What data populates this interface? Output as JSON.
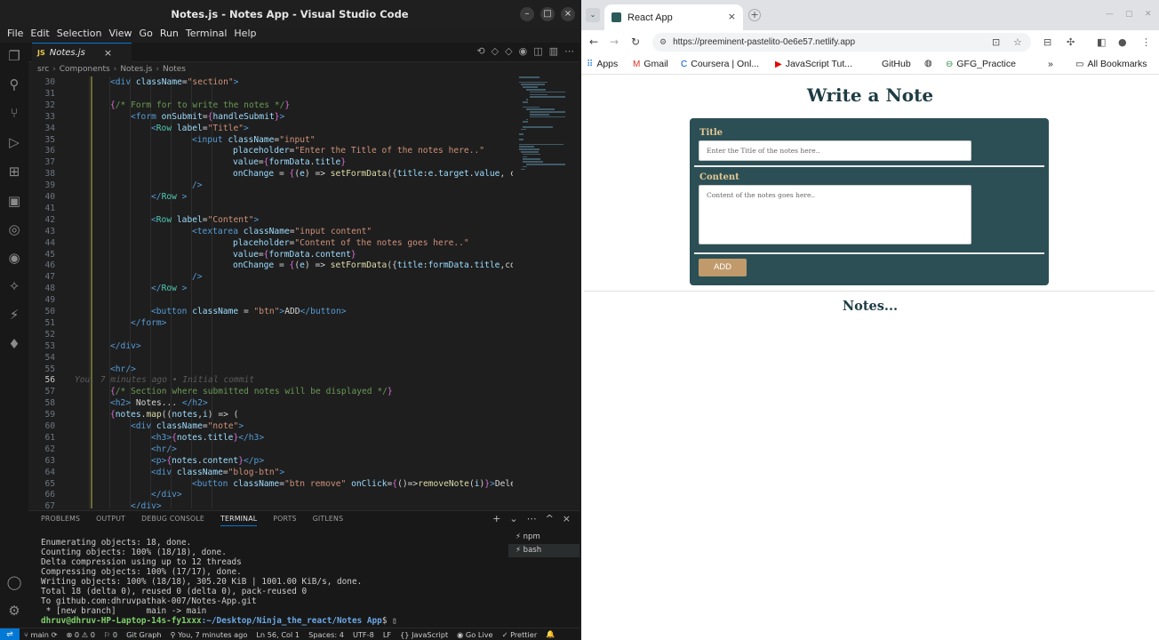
{
  "vscode": {
    "title": "Notes.js - Notes App - Visual Studio Code",
    "menu": [
      "File",
      "Edit",
      "Selection",
      "View",
      "Go",
      "Run",
      "Terminal",
      "Help"
    ],
    "tab": {
      "badge": "JS",
      "label": "Notes.js"
    },
    "breadcrumb": [
      "src",
      "Components",
      "Notes.js",
      "Notes"
    ],
    "blame": "You, 7 minutes ago • Initial commit",
    "lines": [
      {
        "n": "30",
        "tokens": [
          [
            "tag",
            "<div "
          ],
          [
            "attr",
            "className"
          ],
          [
            "plain",
            "="
          ],
          [
            "str",
            "\"section\""
          ],
          [
            "tag",
            ">"
          ]
        ],
        "i": 2
      },
      {
        "n": "31",
        "tokens": [],
        "i": 0
      },
      {
        "n": "32",
        "tokens": [
          [
            "brace",
            "{"
          ],
          [
            "comment",
            "/* Form for to write the notes */"
          ],
          [
            "brace",
            "}"
          ]
        ],
        "i": 2
      },
      {
        "n": "33",
        "tokens": [
          [
            "tag",
            "<form "
          ],
          [
            "attr",
            "onSubmit"
          ],
          [
            "plain",
            "="
          ],
          [
            "brace",
            "{"
          ],
          [
            "var",
            "handleSubmit"
          ],
          [
            "brace",
            "}"
          ],
          [
            "tag",
            ">"
          ]
        ],
        "i": 3
      },
      {
        "n": "34",
        "tokens": [
          [
            "tag",
            "<"
          ],
          [
            "comp",
            "Row "
          ],
          [
            "attr",
            "label"
          ],
          [
            "plain",
            "="
          ],
          [
            "str",
            "\"Title\""
          ],
          [
            "tag",
            ">"
          ]
        ],
        "i": 4
      },
      {
        "n": "35",
        "tokens": [
          [
            "tag",
            "<input "
          ],
          [
            "attr",
            "className"
          ],
          [
            "plain",
            "="
          ],
          [
            "str",
            "\"input\""
          ]
        ],
        "i": 6
      },
      {
        "n": "36",
        "tokens": [
          [
            "attr",
            "placeholder"
          ],
          [
            "plain",
            "="
          ],
          [
            "str",
            "\"Enter the Title of the notes here..\""
          ]
        ],
        "i": 8
      },
      {
        "n": "37",
        "tokens": [
          [
            "attr",
            "value"
          ],
          [
            "plain",
            "="
          ],
          [
            "brace",
            "{"
          ],
          [
            "var",
            "formData"
          ],
          [
            "plain",
            "."
          ],
          [
            "var",
            "title"
          ],
          [
            "brace",
            "}"
          ]
        ],
        "i": 8
      },
      {
        "n": "38",
        "tokens": [
          [
            "attr",
            "onChange"
          ],
          [
            "plain",
            " = "
          ],
          [
            "brace",
            "{"
          ],
          [
            "plain",
            "("
          ],
          [
            "var",
            "e"
          ],
          [
            "plain",
            ") => "
          ],
          [
            "fn",
            "setFormData"
          ],
          [
            "plain",
            "({"
          ],
          [
            "var",
            "title"
          ],
          [
            "plain",
            ":"
          ],
          [
            "var",
            "e"
          ],
          [
            "plain",
            "."
          ],
          [
            "var",
            "target"
          ],
          [
            "plain",
            "."
          ],
          [
            "var",
            "value"
          ],
          [
            "plain",
            ", c"
          ]
        ],
        "i": 8
      },
      {
        "n": "39",
        "tokens": [
          [
            "tag",
            "/>"
          ]
        ],
        "i": 6
      },
      {
        "n": "40",
        "tokens": [
          [
            "tag",
            "</"
          ],
          [
            "comp",
            "Row"
          ],
          [
            "tag",
            " >"
          ]
        ],
        "i": 4
      },
      {
        "n": "41",
        "tokens": [],
        "i": 0
      },
      {
        "n": "42",
        "tokens": [
          [
            "tag",
            "<"
          ],
          [
            "comp",
            "Row "
          ],
          [
            "attr",
            "label"
          ],
          [
            "plain",
            "="
          ],
          [
            "str",
            "\"Content\""
          ],
          [
            "tag",
            ">"
          ]
        ],
        "i": 4
      },
      {
        "n": "43",
        "tokens": [
          [
            "tag",
            "<textarea "
          ],
          [
            "attr",
            "className"
          ],
          [
            "plain",
            "="
          ],
          [
            "str",
            "\"input content\""
          ]
        ],
        "i": 6
      },
      {
        "n": "44",
        "tokens": [
          [
            "attr",
            "placeholder"
          ],
          [
            "plain",
            "="
          ],
          [
            "str",
            "\"Content of the notes goes here..\""
          ]
        ],
        "i": 8
      },
      {
        "n": "45",
        "tokens": [
          [
            "attr",
            "value"
          ],
          [
            "plain",
            "="
          ],
          [
            "brace",
            "{"
          ],
          [
            "var",
            "formData"
          ],
          [
            "plain",
            "."
          ],
          [
            "var",
            "content"
          ],
          [
            "brace",
            "}"
          ]
        ],
        "i": 8
      },
      {
        "n": "46",
        "tokens": [
          [
            "attr",
            "onChange"
          ],
          [
            "plain",
            " = "
          ],
          [
            "brace",
            "{"
          ],
          [
            "plain",
            "("
          ],
          [
            "var",
            "e"
          ],
          [
            "plain",
            ") => "
          ],
          [
            "fn",
            "setFormData"
          ],
          [
            "plain",
            "({"
          ],
          [
            "var",
            "title"
          ],
          [
            "plain",
            ":"
          ],
          [
            "var",
            "formData"
          ],
          [
            "plain",
            "."
          ],
          [
            "var",
            "title"
          ],
          [
            "plain",
            ",co"
          ]
        ],
        "i": 8
      },
      {
        "n": "47",
        "tokens": [
          [
            "tag",
            "/>"
          ]
        ],
        "i": 6
      },
      {
        "n": "48",
        "tokens": [
          [
            "tag",
            "</"
          ],
          [
            "comp",
            "Row"
          ],
          [
            "tag",
            " >"
          ]
        ],
        "i": 4
      },
      {
        "n": "49",
        "tokens": [],
        "i": 0
      },
      {
        "n": "50",
        "tokens": [
          [
            "tag",
            "<button "
          ],
          [
            "attr",
            "className"
          ],
          [
            "plain",
            " = "
          ],
          [
            "str",
            "\"btn\""
          ],
          [
            "tag",
            ">"
          ],
          [
            "plain",
            "ADD"
          ],
          [
            "tag",
            "</button>"
          ]
        ],
        "i": 4
      },
      {
        "n": "51",
        "tokens": [
          [
            "tag",
            "</form>"
          ]
        ],
        "i": 3
      },
      {
        "n": "52",
        "tokens": [],
        "i": 0
      },
      {
        "n": "53",
        "tokens": [
          [
            "tag",
            "</div>"
          ]
        ],
        "i": 2
      },
      {
        "n": "54",
        "tokens": [],
        "i": 0
      },
      {
        "n": "55",
        "tokens": [
          [
            "tag",
            "<hr/>"
          ]
        ],
        "i": 2
      },
      {
        "n": "56",
        "tokens": [],
        "i": 0,
        "blame": true,
        "current": true
      },
      {
        "n": "57",
        "tokens": [
          [
            "brace",
            "{"
          ],
          [
            "comment",
            "/* Section where submitted notes will be displayed */"
          ],
          [
            "brace",
            "}"
          ]
        ],
        "i": 2
      },
      {
        "n": "58",
        "tokens": [
          [
            "tag",
            "<h2>"
          ],
          [
            "plain",
            " Notes... "
          ],
          [
            "tag",
            "</h2>"
          ]
        ],
        "i": 2
      },
      {
        "n": "59",
        "tokens": [
          [
            "brace",
            "{"
          ],
          [
            "var",
            "notes"
          ],
          [
            "plain",
            "."
          ],
          [
            "fn",
            "map"
          ],
          [
            "plain",
            "(("
          ],
          [
            "var",
            "notes"
          ],
          [
            "plain",
            ","
          ],
          [
            "var",
            "i"
          ],
          [
            "plain",
            ") => ("
          ]
        ],
        "i": 2
      },
      {
        "n": "60",
        "tokens": [
          [
            "tag",
            "<div "
          ],
          [
            "attr",
            "className"
          ],
          [
            "plain",
            "="
          ],
          [
            "str",
            "\"note\""
          ],
          [
            "tag",
            ">"
          ]
        ],
        "i": 3
      },
      {
        "n": "61",
        "tokens": [
          [
            "tag",
            "<h3>"
          ],
          [
            "brace",
            "{"
          ],
          [
            "var",
            "notes"
          ],
          [
            "plain",
            "."
          ],
          [
            "var",
            "title"
          ],
          [
            "brace",
            "}"
          ],
          [
            "tag",
            "</h3>"
          ]
        ],
        "i": 4
      },
      {
        "n": "62",
        "tokens": [
          [
            "tag",
            "<hr/>"
          ]
        ],
        "i": 4
      },
      {
        "n": "63",
        "tokens": [
          [
            "tag",
            "<p>"
          ],
          [
            "brace",
            "{"
          ],
          [
            "var",
            "notes"
          ],
          [
            "plain",
            "."
          ],
          [
            "var",
            "content"
          ],
          [
            "brace",
            "}"
          ],
          [
            "tag",
            "</p>"
          ]
        ],
        "i": 4
      },
      {
        "n": "64",
        "tokens": [
          [
            "tag",
            "<div "
          ],
          [
            "attr",
            "className"
          ],
          [
            "plain",
            "="
          ],
          [
            "str",
            "\"blog-btn\""
          ],
          [
            "tag",
            ">"
          ]
        ],
        "i": 4
      },
      {
        "n": "65",
        "tokens": [
          [
            "tag",
            "<button "
          ],
          [
            "attr",
            "className"
          ],
          [
            "plain",
            "="
          ],
          [
            "str",
            "\"btn remove\""
          ],
          [
            "plain",
            " "
          ],
          [
            "attr",
            "onClick"
          ],
          [
            "plain",
            "="
          ],
          [
            "brace",
            "{"
          ],
          [
            "plain",
            "()=>"
          ],
          [
            "fn",
            "removeNote"
          ],
          [
            "plain",
            "("
          ],
          [
            "var",
            "i"
          ],
          [
            "plain",
            ")"
          ],
          [
            "brace",
            "}"
          ],
          [
            "tag",
            ">"
          ],
          [
            "plain",
            "Delete"
          ],
          [
            "tag",
            "</"
          ]
        ],
        "i": 6
      },
      {
        "n": "66",
        "tokens": [
          [
            "tag",
            "</div>"
          ]
        ],
        "i": 4
      },
      {
        "n": "67",
        "tokens": [
          [
            "tag",
            "</div>"
          ]
        ],
        "i": 3
      }
    ],
    "panel": {
      "tabs": [
        "PROBLEMS",
        "OUTPUT",
        "DEBUG CONSOLE",
        "TERMINAL",
        "PORTS",
        "GITLENS"
      ],
      "active_tab": "TERMINAL",
      "terminal_lines": [
        "Enumerating objects: 18, done.",
        "Counting objects: 100% (18/18), done.",
        "Delta compression using up to 12 threads",
        "Compressing objects: 100% (17/17), done.",
        "Writing objects: 100% (18/18), 305.20 KiB | 1001.00 KiB/s, done.",
        "Total 18 (delta 0), reused 0 (delta 0), pack-reused 0",
        "To github.com:dhruvpathak-007/Notes-App.git",
        " * [new branch]      main -> main"
      ],
      "prompt_user": "dhruv@dhruv-HP-Laptop-14s-fy1xxx",
      "prompt_path": ":~/Desktop/Ninja_the_react/Notes App",
      "prompt_symbol": "$ ",
      "terminals": [
        "npm",
        "bash"
      ]
    },
    "status": {
      "branch": "main",
      "errors": "0",
      "warnings": "0",
      "ports": "0",
      "git_graph": "Git Graph",
      "blame": "You, 7 minutes ago",
      "position": "Ln 56, Col 1",
      "spaces": "Spaces: 4",
      "encoding": "UTF-8",
      "eol": "LF",
      "language": "JavaScript",
      "go_live": "Go Live",
      "prettier": "Prettier"
    }
  },
  "chrome": {
    "tab_title": "React App",
    "url": "https://preeminent-pastelito-0e6e57.netlify.app",
    "bookmarks": [
      "Apps",
      "Gmail",
      "Coursera | Onl...",
      "JavaScript Tut...",
      "GitHub",
      "GFG_Practice"
    ],
    "all_bookmarks": "All Bookmarks",
    "page": {
      "heading": "Write a Note",
      "title_label": "Title",
      "title_placeholder": "Enter the Title of the notes here..",
      "content_label": "Content",
      "content_placeholder": "Content of the notes goes here..",
      "add_label": "ADD",
      "notes_heading": "Notes..."
    }
  },
  "colors": {
    "form_bg": "#2b4f55",
    "label": "#e5c792",
    "button": "#c19a6b",
    "heading": "#1d3c44",
    "vscode_accent": "#0078d4"
  }
}
